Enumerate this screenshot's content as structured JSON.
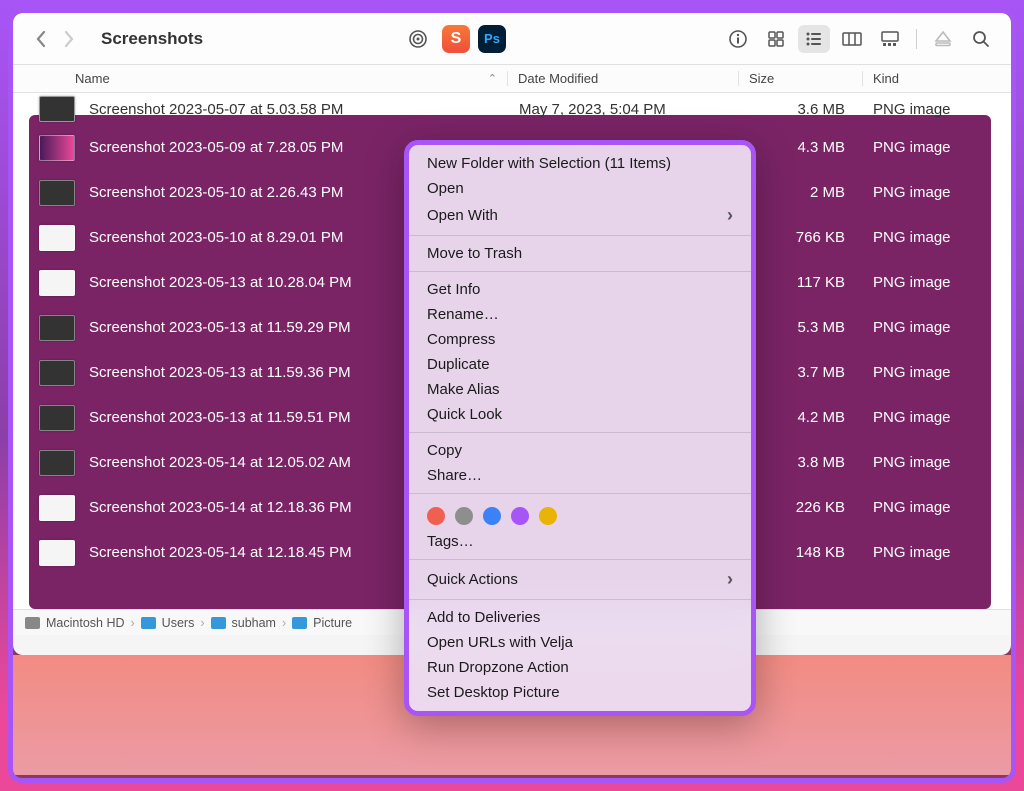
{
  "window": {
    "title": "Screenshots"
  },
  "columns": {
    "name": "Name",
    "date": "Date Modified",
    "size": "Size",
    "kind": "Kind"
  },
  "files": [
    {
      "name": "Screenshot 2023-05-07 at 5.03.58 PM",
      "date": "May 7, 2023, 5:04 PM",
      "size": "3.6 MB",
      "kind": "PNG image"
    },
    {
      "name": "Screenshot 2023-05-09 at 7.28.05 PM",
      "date": "",
      "size": "4.3 MB",
      "kind": "PNG image"
    },
    {
      "name": "Screenshot 2023-05-10 at 2.26.43 PM",
      "date": "",
      "size": "2 MB",
      "kind": "PNG image"
    },
    {
      "name": "Screenshot 2023-05-10 at 8.29.01 PM",
      "date": "",
      "size": "766 KB",
      "kind": "PNG image"
    },
    {
      "name": "Screenshot 2023-05-13 at 10.28.04 PM",
      "date": "",
      "size": "117 KB",
      "kind": "PNG image"
    },
    {
      "name": "Screenshot 2023-05-13 at 11.59.29 PM",
      "date": "",
      "size": "5.3 MB",
      "kind": "PNG image"
    },
    {
      "name": "Screenshot 2023-05-13 at 11.59.36 PM",
      "date": "",
      "size": "3.7 MB",
      "kind": "PNG image"
    },
    {
      "name": "Screenshot 2023-05-13 at 11.59.51 PM",
      "date": "",
      "size": "4.2 MB",
      "kind": "PNG image"
    },
    {
      "name": "Screenshot 2023-05-14 at 12.05.02 AM",
      "date": "",
      "size": "3.8 MB",
      "kind": "PNG image"
    },
    {
      "name": "Screenshot 2023-05-14 at 12.18.36 PM",
      "date": "",
      "size": "226 KB",
      "kind": "PNG image"
    },
    {
      "name": "Screenshot 2023-05-14 at 12.18.45 PM",
      "date": "",
      "size": "148 KB",
      "kind": "PNG image"
    }
  ],
  "pathbar": [
    "Macintosh HD",
    "Users",
    "subham",
    "Picture"
  ],
  "context_menu": {
    "groups": [
      [
        "New Folder with Selection (11 Items)",
        "Open",
        "Open With"
      ],
      [
        "Move to Trash"
      ],
      [
        "Get Info",
        "Rename…",
        "Compress",
        "Duplicate",
        "Make Alias",
        "Quick Look"
      ],
      [
        "Copy",
        "Share…"
      ]
    ],
    "tags_label": "Tags…",
    "tag_colors": [
      "#f06050",
      "#8e8e8e",
      "#3b82f6",
      "#a855f7",
      "#eab308"
    ],
    "post_groups": [
      [
        "Quick Actions"
      ],
      [
        "Add to Deliveries",
        "Open URLs with Velja",
        "Run Dropzone Action",
        "Set Desktop Picture"
      ]
    ],
    "submenu_items": [
      "Open With",
      "Quick Actions"
    ]
  }
}
